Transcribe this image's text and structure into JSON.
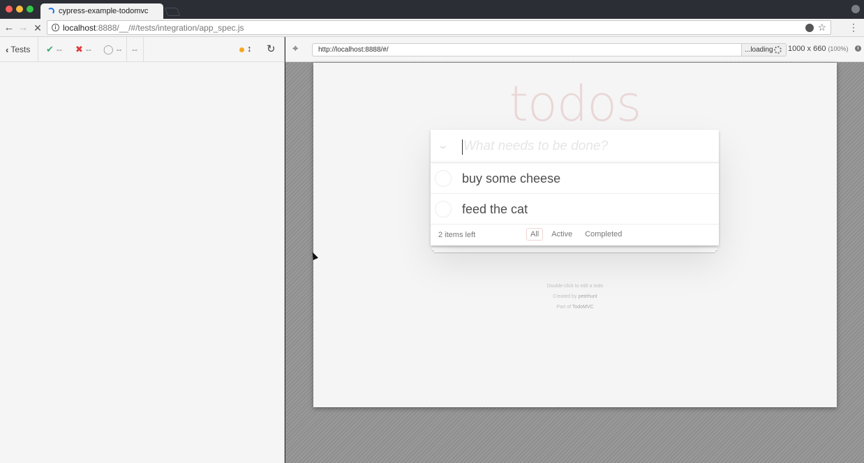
{
  "browser": {
    "tab_title": "cypress-example-todomvc",
    "url_host": "localhost",
    "url_path": ":8888/__/#/tests/integration/app_spec.js"
  },
  "reporter": {
    "tests_label": "Tests",
    "passed": "--",
    "failed": "--",
    "pending": "--",
    "duration": "--"
  },
  "runner": {
    "aut_url": "http://localhost:8888/#/",
    "loading_label": "...loading",
    "viewport_size": "1000 x 660",
    "viewport_scale": "(100%)"
  },
  "todo": {
    "title": "todos",
    "placeholder": "What needs to be done?",
    "items": [
      {
        "label": "buy some cheese"
      },
      {
        "label": "feed the cat"
      }
    ],
    "count_text": "2 items left",
    "filters": [
      "All",
      "Active",
      "Completed"
    ],
    "selected_filter": "All",
    "info": {
      "edit_hint": "Double-click to edit a todo",
      "created_by_prefix": "Created by ",
      "created_by_name": "petehunt",
      "part_of_prefix": "Part of ",
      "part_of_name": "TodoMVC"
    }
  },
  "colors": {
    "passed": "#3ca86b",
    "failed": "#e03a3a",
    "status_running": "#f5a623",
    "todo_title": "#af2f2f"
  }
}
